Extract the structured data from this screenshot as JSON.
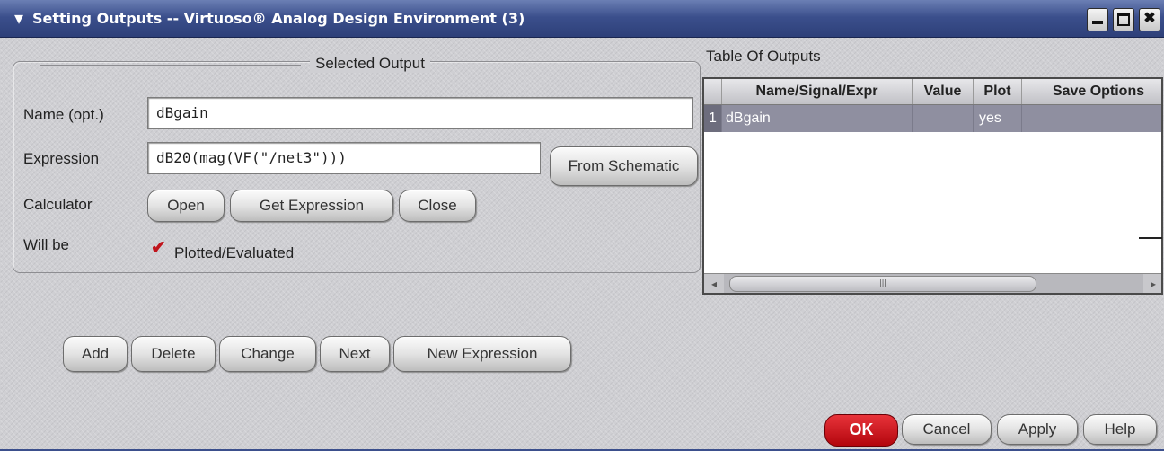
{
  "window": {
    "title": "Setting Outputs -- Virtuoso® Analog Design Environment (3)",
    "menu_glyph": "▾",
    "close_glyph": "✖"
  },
  "selected_output": {
    "group_title": "Selected Output",
    "name_label": "Name (opt.)",
    "name_value": "dBgain",
    "expression_label": "Expression",
    "expression_value": "dB20(mag(VF(\"/net3\")))",
    "from_schematic_label": "From Schematic",
    "calculator_label": "Calculator",
    "open_label": "Open",
    "get_expression_label": "Get Expression",
    "close_label": "Close",
    "will_be_label": "Will be",
    "plotted_label": "Plotted/Evaluated",
    "plotted_checked": true
  },
  "actions": {
    "add": "Add",
    "delete": "Delete",
    "change": "Change",
    "next": "Next",
    "new_expression": "New Expression"
  },
  "table": {
    "title": "Table Of Outputs",
    "columns": [
      "Name/Signal/Expr",
      "Value",
      "Plot",
      "Save Options"
    ],
    "rows": [
      {
        "index": "1",
        "name": "dBgain",
        "value": "",
        "plot": "yes",
        "save": ""
      }
    ],
    "scroll_left": "◂",
    "scroll_right": "▸",
    "scroll_grip": "|||"
  },
  "dialog": {
    "ok": "OK",
    "cancel": "Cancel",
    "apply": "Apply",
    "help": "Help"
  },
  "colors": {
    "title_bar": "#3b4f8c",
    "selected_row": "#8f8fa0",
    "ok_button": "#c8141c"
  }
}
